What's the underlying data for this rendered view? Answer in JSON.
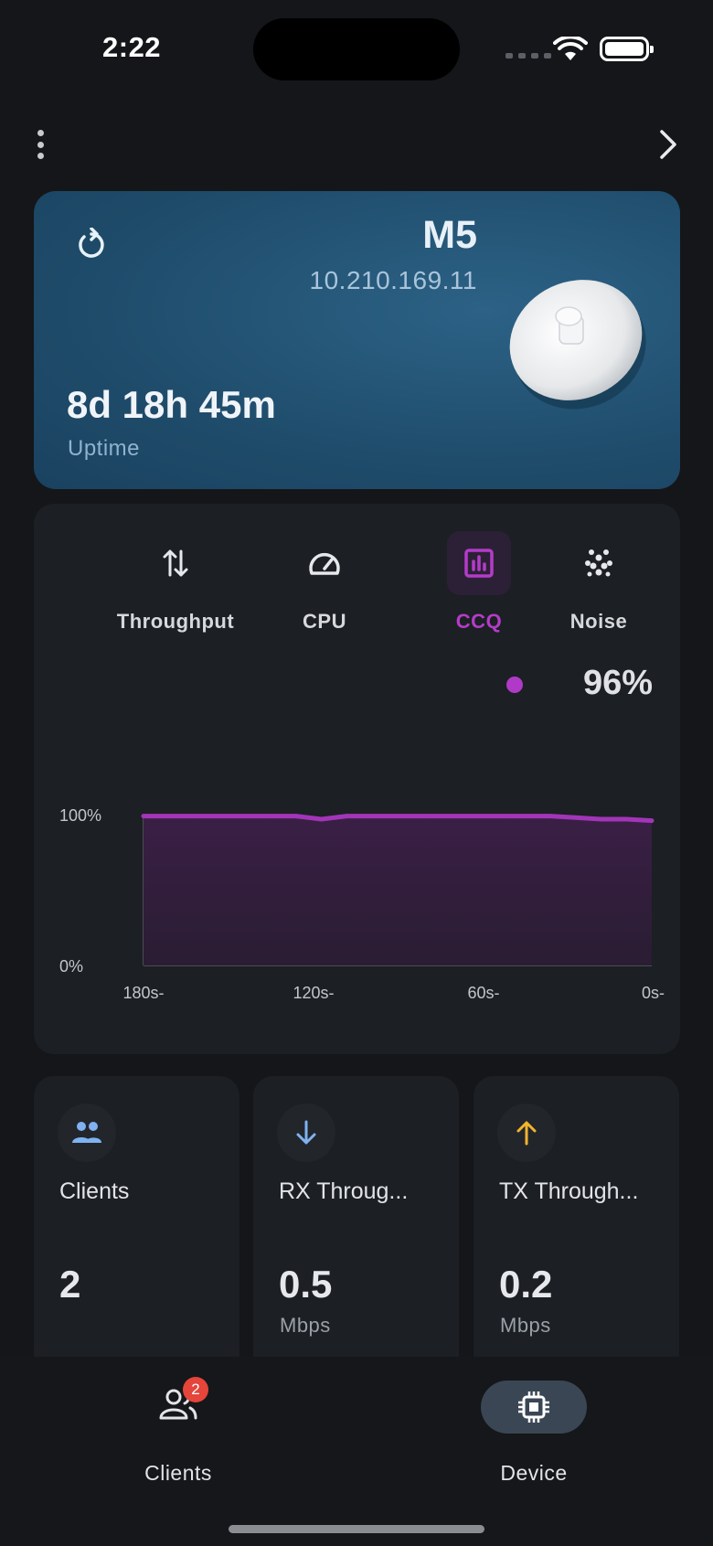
{
  "status_bar": {
    "time": "2:22"
  },
  "device": {
    "name": "M5",
    "ip": "10.210.169.11",
    "uptime": "8d 18h 45m",
    "uptime_label": "Uptime"
  },
  "tabs": [
    {
      "label": "Throughput",
      "icon": "swap-vertical-icon",
      "active": false
    },
    {
      "label": "CPU",
      "icon": "speedometer-icon",
      "active": false
    },
    {
      "label": "CCQ",
      "icon": "bar-chart-icon",
      "active": true
    },
    {
      "label": "Noise",
      "icon": "dots-grid-icon",
      "active": false
    }
  ],
  "current_value": "96%",
  "chart_data": {
    "type": "area",
    "series": [
      {
        "name": "CCQ",
        "color": "#a235b8",
        "x": [
          180,
          171,
          162,
          153,
          144,
          135,
          126,
          117,
          108,
          99,
          90,
          81,
          72,
          63,
          54,
          45,
          36,
          27,
          18,
          9,
          0
        ],
        "y": [
          99,
          99,
          99,
          99,
          99,
          99,
          99,
          97,
          99,
          99,
          99,
          99,
          99,
          99,
          99,
          99,
          99,
          98,
          97,
          97,
          96
        ]
      }
    ],
    "ylim": [
      0,
      100
    ],
    "xlim": [
      180,
      0
    ],
    "ytick_labels": [
      "100%",
      "0%"
    ],
    "xtick_labels": [
      "180s-",
      "120s-",
      "60s-",
      "0s-"
    ],
    "grid": "midline dashed"
  },
  "stats": [
    {
      "title": "Clients",
      "value": "2",
      "unit": "",
      "icon": "people-icon",
      "accent": "#7fb2f0"
    },
    {
      "title": "RX Throug...",
      "value": "0.5",
      "unit": "Mbps",
      "icon": "arrow-down-icon",
      "accent": "#7fb2f0"
    },
    {
      "title": "TX Through...",
      "value": "0.2",
      "unit": "Mbps",
      "icon": "arrow-up-icon",
      "accent": "#f2b32e"
    }
  ],
  "bottom_nav": {
    "clients_label": "Clients",
    "clients_badge": "2",
    "device_label": "Device"
  },
  "colors": {
    "accent": "#b43cc8",
    "card": "#1c1f23",
    "hero": "#1f4c6b"
  }
}
